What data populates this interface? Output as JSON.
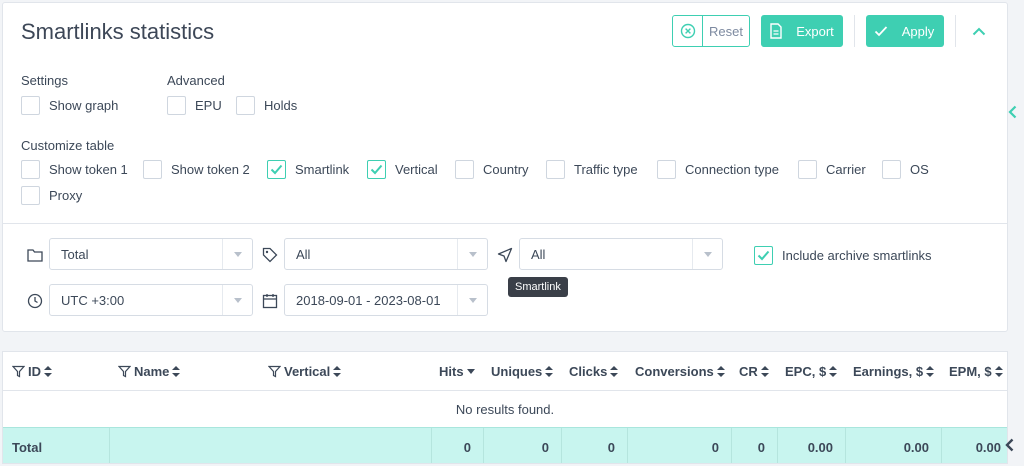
{
  "header": {
    "title": "Smartlinks statistics",
    "reset_label": "Reset",
    "export_label": "Export",
    "apply_label": "Apply"
  },
  "settings": {
    "label": "Settings",
    "items": [
      {
        "label": "Show graph",
        "checked": false
      }
    ]
  },
  "advanced": {
    "label": "Advanced",
    "items": [
      {
        "label": "EPU",
        "checked": false
      },
      {
        "label": "Holds",
        "checked": false
      }
    ]
  },
  "customize": {
    "label": "Customize table",
    "items": [
      {
        "label": "Show token 1",
        "checked": false
      },
      {
        "label": "Show token 2",
        "checked": false
      },
      {
        "label": "Smartlink",
        "checked": true
      },
      {
        "label": "Vertical",
        "checked": true
      },
      {
        "label": "Country",
        "checked": false
      },
      {
        "label": "Traffic type",
        "checked": false
      },
      {
        "label": "Connection type",
        "checked": false
      },
      {
        "label": "Carrier",
        "checked": false
      },
      {
        "label": "OS",
        "checked": false
      },
      {
        "label": "Proxy",
        "checked": false
      }
    ]
  },
  "filters": {
    "group_by": "Total",
    "tag": "All",
    "smartlink": "All",
    "smartlink_tooltip": "Smartlink",
    "include_archive": {
      "label": "Include archive smartlinks",
      "checked": true
    },
    "timezone": "UTC +3:00",
    "date_range": "2018-09-01 - 2023-08-01"
  },
  "table": {
    "columns": [
      "ID",
      "Name",
      "Vertical",
      "Hits",
      "Uniques",
      "Clicks",
      "Conversions",
      "CR",
      "EPC, $",
      "Earnings, $",
      "EPM, $"
    ],
    "empty_message": "No results found.",
    "total": {
      "label": "Total",
      "hits": "0",
      "uniques": "0",
      "clicks": "0",
      "conversions": "0",
      "cr": "0",
      "epc": "0.00",
      "earnings": "0.00",
      "epm": "0.00"
    }
  },
  "colors": {
    "accent": "#3ecfb2",
    "total_row": "#c8f5ef"
  }
}
